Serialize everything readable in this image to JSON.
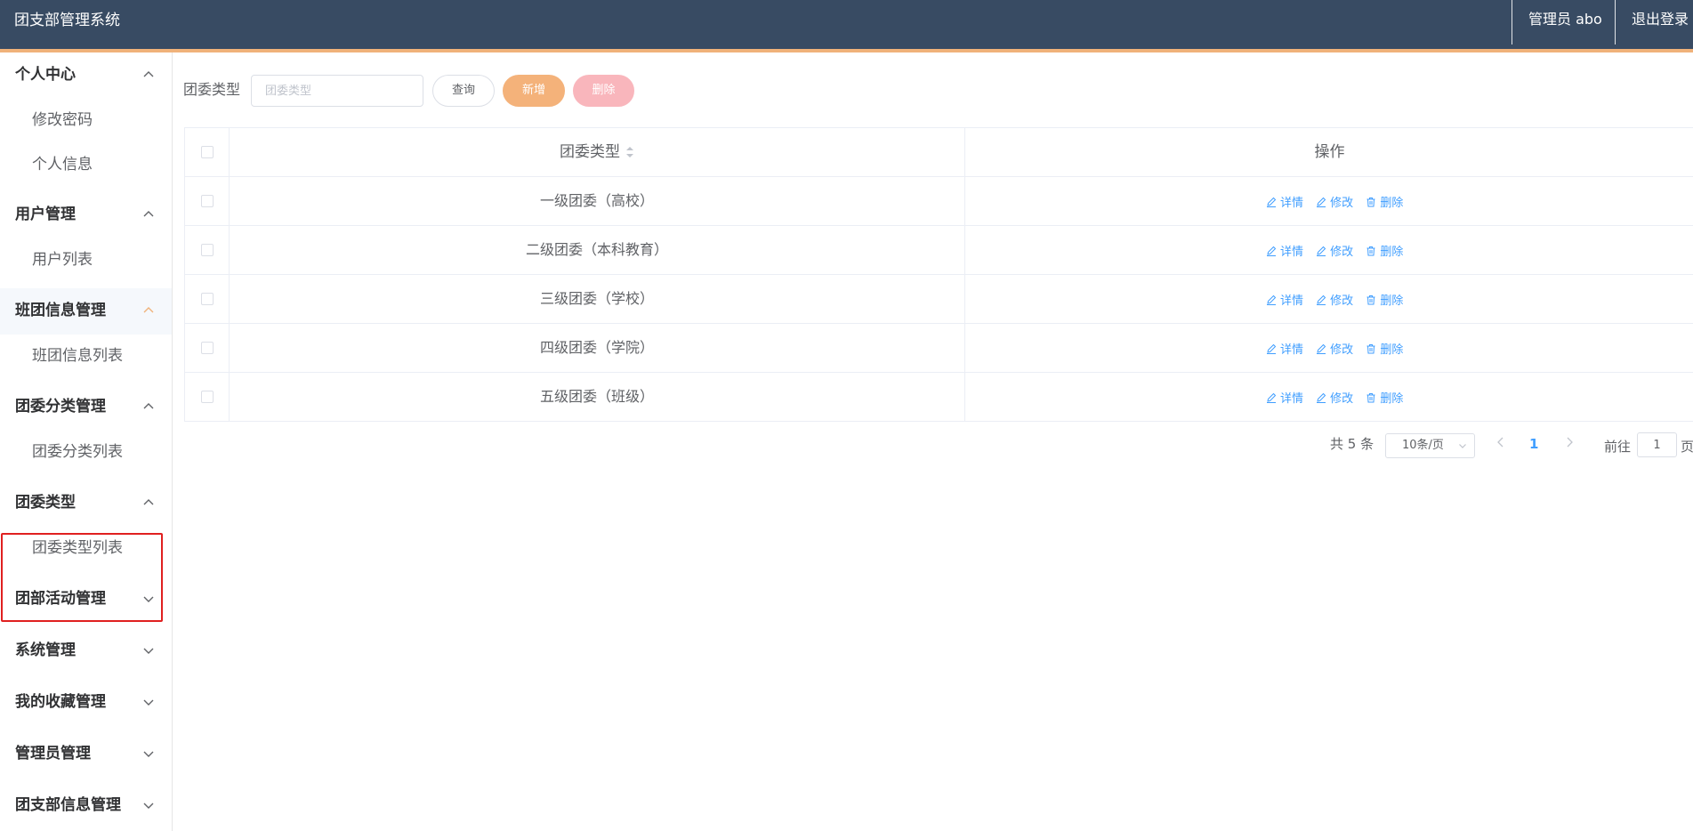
{
  "header": {
    "app_title": "团支部管理系统",
    "user_label": "管理员 abo",
    "logout_label": "退出登录"
  },
  "sidebar": {
    "groups": [
      {
        "title": "个人中心",
        "expanded": true,
        "items": [
          "修改密码",
          "个人信息"
        ]
      },
      {
        "title": "用户管理",
        "expanded": true,
        "items": [
          "用户列表"
        ]
      },
      {
        "title": "班团信息管理",
        "expanded": true,
        "items": [
          "班团信息列表"
        ]
      },
      {
        "title": "团委分类管理",
        "expanded": true,
        "items": [
          "团委分类列表"
        ]
      },
      {
        "title": "团委类型",
        "expanded": true,
        "items": [
          "团委类型列表"
        ]
      },
      {
        "title": "团部活动管理",
        "expanded": false,
        "items": []
      },
      {
        "title": "系统管理",
        "expanded": false,
        "items": []
      },
      {
        "title": "我的收藏管理",
        "expanded": false,
        "items": []
      },
      {
        "title": "管理员管理",
        "expanded": false,
        "items": []
      },
      {
        "title": "团支部信息管理",
        "expanded": false,
        "items": []
      }
    ]
  },
  "toolbar": {
    "search_label": "团委类型",
    "search_placeholder": "团委类型",
    "search_value": "",
    "query_label": "查询",
    "add_label": "新增",
    "delete_label": "删除"
  },
  "table": {
    "columns": [
      "团委类型",
      "操作"
    ],
    "rows": [
      {
        "type": "一级团委（高校）"
      },
      {
        "type": "二级团委（本科教育）"
      },
      {
        "type": "三级团委（学校）"
      },
      {
        "type": "四级团委（学院）"
      },
      {
        "type": "五级团委（班级）"
      }
    ],
    "actions": {
      "detail": "详情",
      "edit": "修改",
      "delete": "删除"
    }
  },
  "pagination": {
    "total_label": "共 5 条",
    "page_size_label": "10条/页",
    "current_page": "1",
    "goto_label": "前往",
    "goto_value": "1",
    "page_unit": "页"
  },
  "colors": {
    "header_bg": "#384b63",
    "header_accent": "#f0b27a",
    "link": "#409eff",
    "add_button": "#f4b27a",
    "delete_button": "#f9b6bc",
    "highlight_box": "#e02020"
  },
  "icons": [
    "chevron-up-icon",
    "chevron-down-icon",
    "edit-icon",
    "trash-icon",
    "sort-caret-icon",
    "chevron-left-icon",
    "chevron-right-icon"
  ]
}
